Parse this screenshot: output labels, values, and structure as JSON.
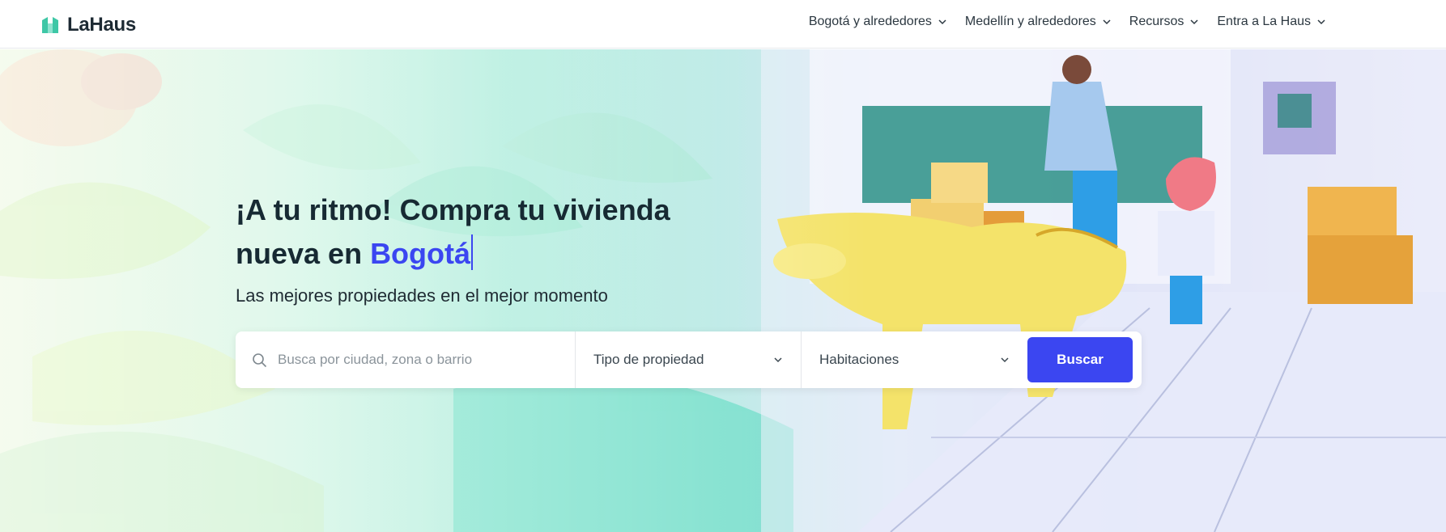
{
  "brand": {
    "name": "LaHaus",
    "accent": "#3b46f1",
    "logo_color": "#3ec7a6"
  },
  "nav": {
    "items": [
      {
        "label": "Bogotá y alrededores"
      },
      {
        "label": "Medellín y alrededores"
      },
      {
        "label": "Recursos"
      },
      {
        "label": "Entra a La Haus"
      }
    ]
  },
  "hero": {
    "headline_prefix": "¡A tu ritmo! Compra tu vivienda nueva en ",
    "headline_city": "Bogotá",
    "subheadline": "Las mejores propiedades en el mejor momento"
  },
  "search": {
    "location_placeholder": "Busca por ciudad, zona o barrio",
    "property_type_label": "Tipo de propiedad",
    "rooms_label": "Habitaciones",
    "submit_label": "Buscar"
  },
  "icons": {
    "search": "search-icon",
    "chevron": "chevron-down-icon",
    "logo": "house-logo-icon"
  }
}
